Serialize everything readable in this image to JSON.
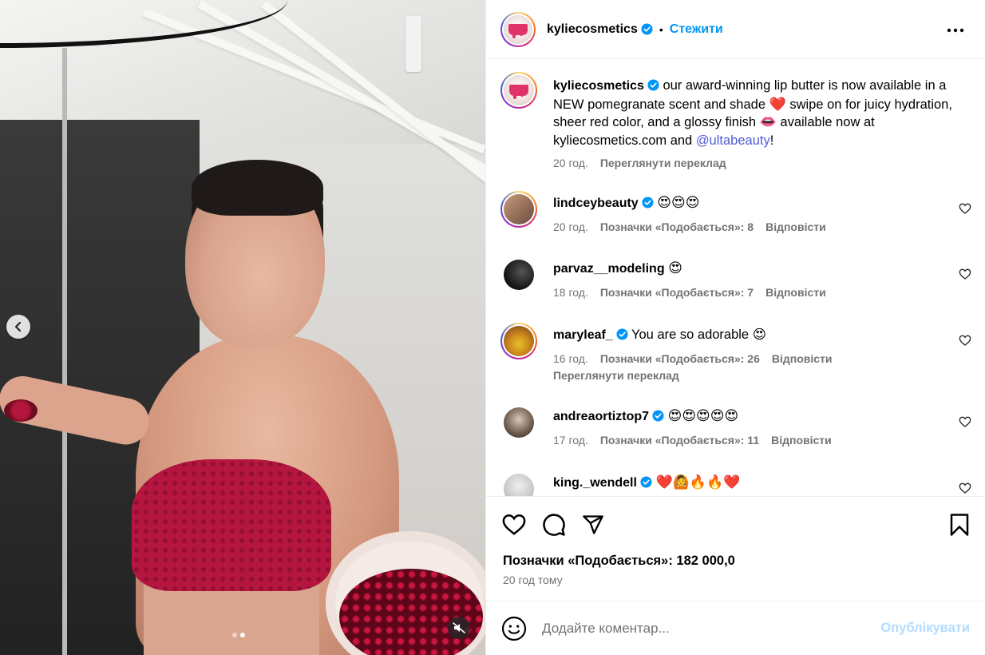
{
  "colors": {
    "link_blue": "#0095f6",
    "mention": "#4f5bd5",
    "muted": "#737373",
    "publish_disabled": "#b3dbff"
  },
  "media": {
    "carousel_dots": 2,
    "active_dot": 2,
    "icons": [
      "chevron-left-icon",
      "speaker-muted-icon"
    ]
  },
  "header": {
    "username": "kyliecosmetics",
    "follow_label": "Стежити",
    "separator": "•",
    "more_icon": "more-horizontal-icon"
  },
  "caption": {
    "username": "kyliecosmetics",
    "text_part1": " our award-winning lip butter is now available in a NEW pomegranate scent and shade ",
    "emoji1": "❤️",
    "text_part2": " swipe on for juicy hydration, sheer red color, and a glossy finish ",
    "emoji2": "👄",
    "text_part3": " available now at kyliecosmetics.com and ",
    "mention": "@ultabeauty",
    "text_end": "!",
    "time": "20 год.",
    "translate": "Переглянути переклад"
  },
  "comments": [
    {
      "username": "lindceybeauty",
      "verified": true,
      "text": "😍😍😍",
      "time": "20 год.",
      "likes": "Позначки «Подобається»: 8",
      "reply": "Відповісти"
    },
    {
      "username": "parvaz__modeling",
      "verified": false,
      "text": "😍",
      "time": "18 год.",
      "likes": "Позначки «Подобається»: 7",
      "reply": "Відповісти"
    },
    {
      "username": "maryleaf_",
      "verified": true,
      "text": "You are so adorable 😍",
      "time": "16 год.",
      "likes": "Позначки «Подобається»: 26",
      "reply": "Відповісти",
      "translate": "Переглянути переклад"
    },
    {
      "username": "andreaortiztop7",
      "verified": true,
      "text": "😍😍😍😍😍",
      "time": "17 год.",
      "likes": "Позначки «Подобається»: 11",
      "reply": "Відповісти"
    },
    {
      "username": "king._wendell",
      "verified": true,
      "text": "❤️🙆🔥🔥❤️"
    }
  ],
  "actions": {
    "likes": "Позначки «Подобається»: 182 000,0",
    "time": "20 год тому",
    "icons": [
      "heart-icon",
      "comment-icon",
      "share-icon",
      "bookmark-icon"
    ]
  },
  "composer": {
    "placeholder": "Додайте коментар...",
    "publish": "Опублікувати"
  }
}
